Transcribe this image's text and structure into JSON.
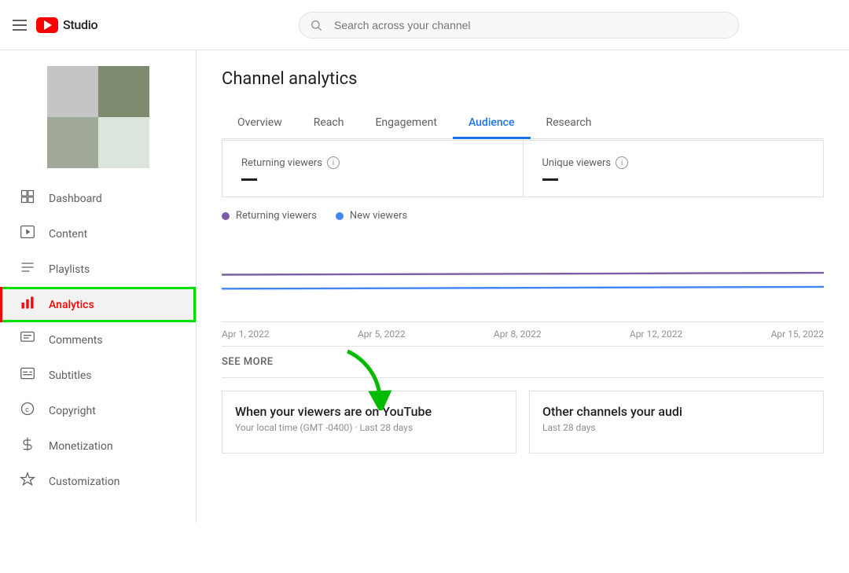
{
  "header": {
    "menu_icon": "☰",
    "logo_text": "Studio",
    "search_placeholder": "Search across your channel"
  },
  "sidebar": {
    "nav_items": [
      {
        "id": "dashboard",
        "label": "Dashboard",
        "icon": "⊞",
        "active": false
      },
      {
        "id": "content",
        "label": "Content",
        "icon": "▶",
        "active": false
      },
      {
        "id": "playlists",
        "label": "Playlists",
        "icon": "≡",
        "active": false
      },
      {
        "id": "analytics",
        "label": "Analytics",
        "icon": "📊",
        "active": true
      },
      {
        "id": "comments",
        "label": "Comments",
        "icon": "💬",
        "active": false
      },
      {
        "id": "subtitles",
        "label": "Subtitles",
        "icon": "⊟",
        "active": false
      },
      {
        "id": "copyright",
        "label": "Copyright",
        "icon": "©",
        "active": false
      },
      {
        "id": "monetization",
        "label": "Monetization",
        "icon": "$",
        "active": false
      },
      {
        "id": "customization",
        "label": "Customization",
        "icon": "✦",
        "active": false
      }
    ]
  },
  "main": {
    "page_title": "Channel analytics",
    "tabs": [
      {
        "id": "overview",
        "label": "Overview",
        "active": false
      },
      {
        "id": "reach",
        "label": "Reach",
        "active": false
      },
      {
        "id": "engagement",
        "label": "Engagement",
        "active": false
      },
      {
        "id": "audience",
        "label": "Audience",
        "active": true
      },
      {
        "id": "research",
        "label": "Research",
        "active": false
      }
    ],
    "metrics": [
      {
        "id": "returning-viewers",
        "label": "Returning viewers",
        "value": "—"
      },
      {
        "id": "unique-viewers",
        "label": "Unique viewers",
        "value": "—"
      }
    ],
    "legend": [
      {
        "id": "returning",
        "label": "Returning viewers",
        "color": "purple"
      },
      {
        "id": "new",
        "label": "New viewers",
        "color": "blue"
      }
    ],
    "date_labels": [
      "Apr 1, 2022",
      "Apr 5, 2022",
      "Apr 8, 2022",
      "Apr 12, 2022",
      "Apr 15, 2022"
    ],
    "see_more": "SEE MORE",
    "bottom_cards": [
      {
        "id": "viewers-on-yt",
        "title": "When your viewers are on YouTube",
        "subtitle": "Your local time (GMT -0400) · Last 28 days"
      },
      {
        "id": "other-channels",
        "title": "Other channels your audi",
        "subtitle": "Last 28 days"
      }
    ]
  }
}
